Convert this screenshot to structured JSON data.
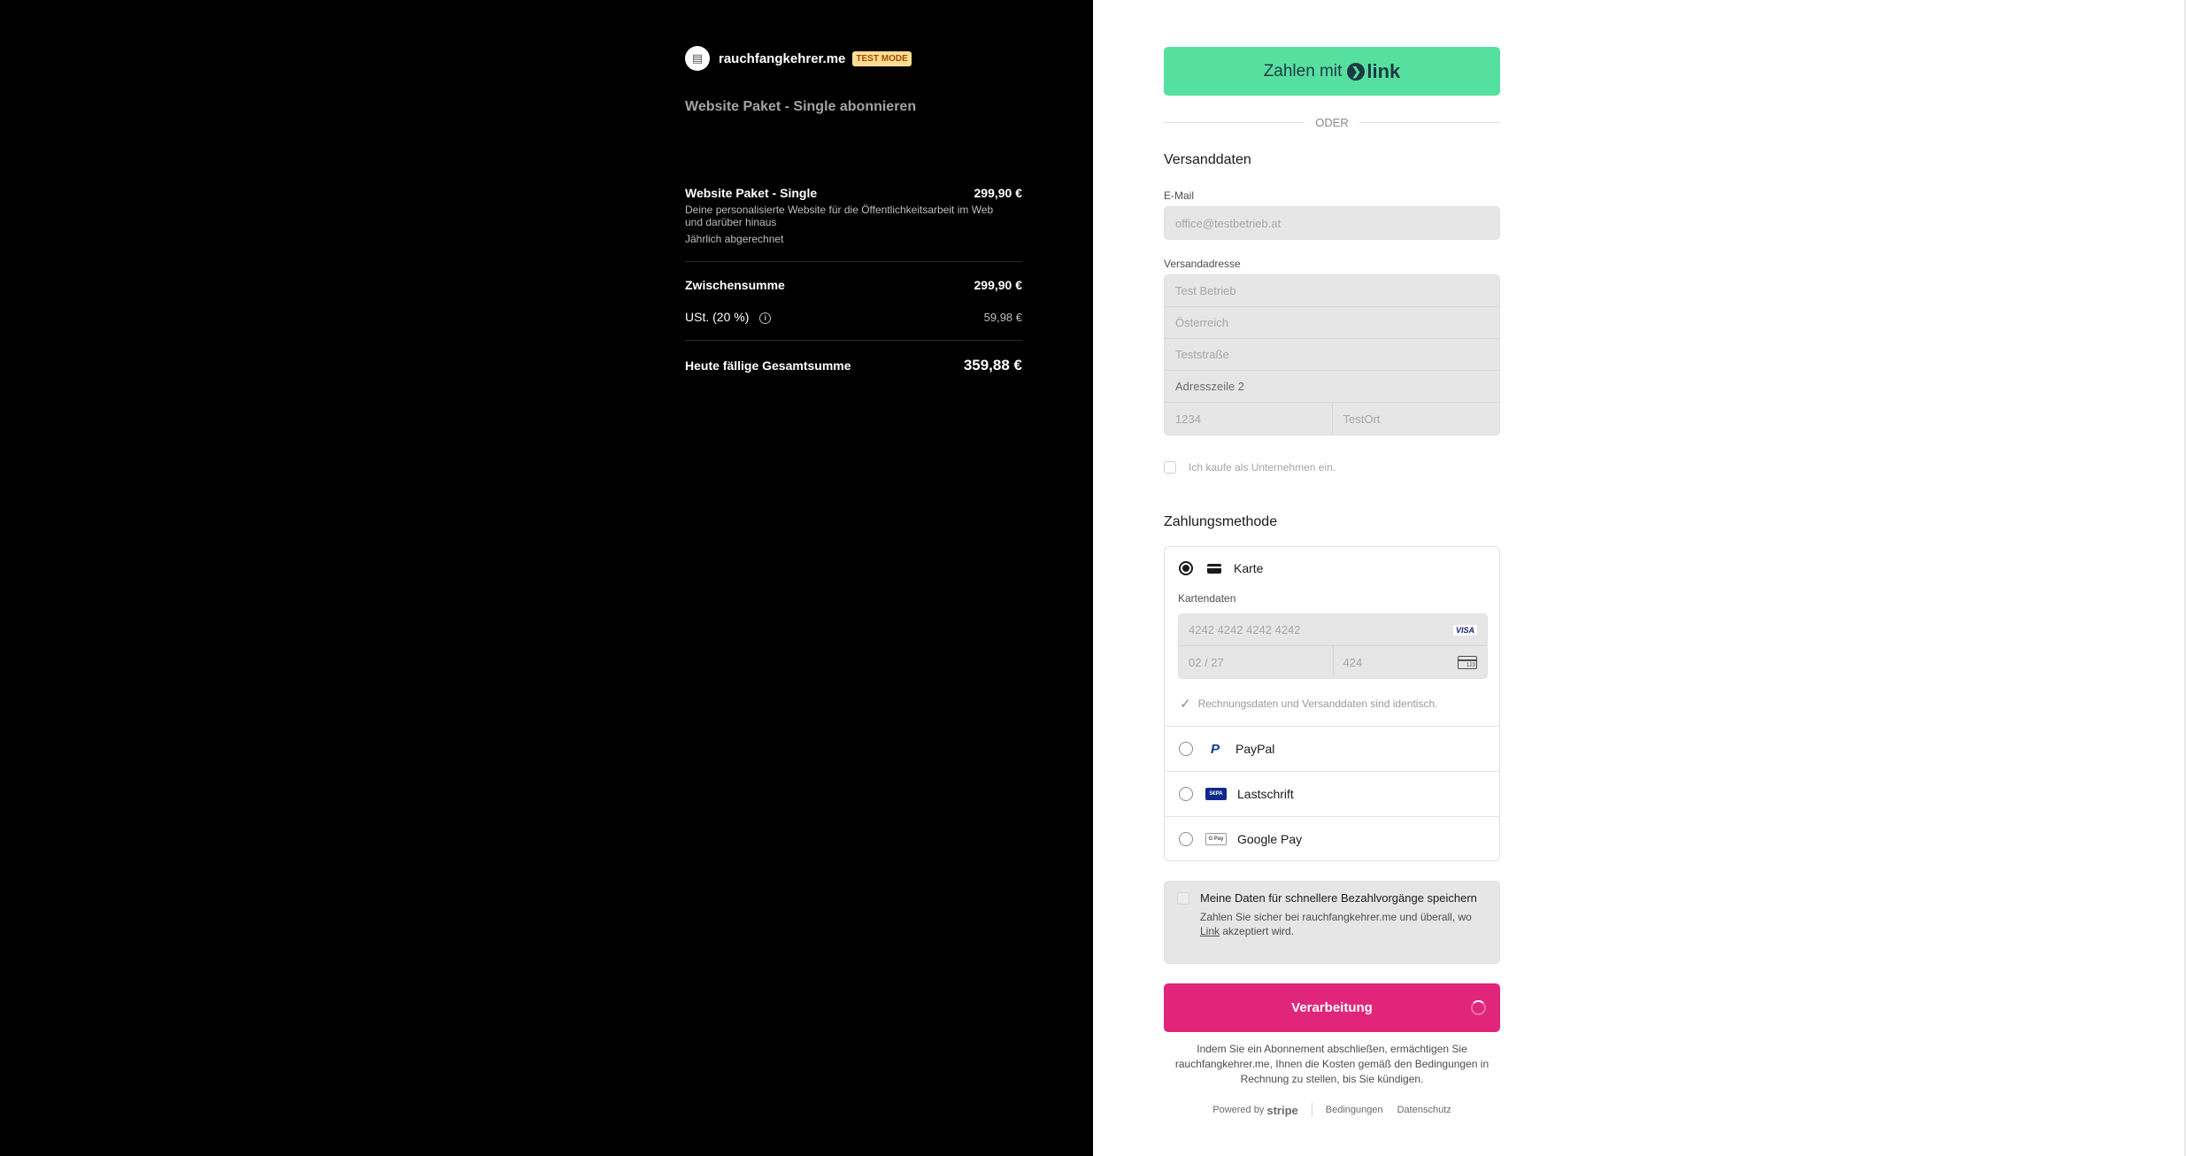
{
  "merchant": {
    "logo_glyph": "▤",
    "name": "rauchfangkehrer.me",
    "test_badge": "TEST MODE"
  },
  "product_heading": "Website Paket - Single abonnieren",
  "summary": {
    "item": {
      "name": "Website Paket - Single",
      "price": "299,90 €",
      "description": "Deine personalisierte Website für die Öffentlichkeitsarbeit im Web und darüber hinaus",
      "billing": "Jährlich abgerechnet"
    },
    "subtotal_label": "Zwischensumme",
    "subtotal_value": "299,90 €",
    "tax_label": "USt. (20 %)",
    "tax_info_glyph": "i",
    "tax_value": "59,98 €",
    "total_label": "Heute fällige Gesamtsumme",
    "total_value": "359,88 €"
  },
  "link_button": {
    "label": "Zahlen mit",
    "logo_arrow": "❯",
    "logo_text": "link"
  },
  "divider_text": "ODER",
  "shipping": {
    "title": "Versanddaten",
    "email_label": "E-Mail",
    "email_value": "office@testbetrieb.at",
    "address_label": "Versandadresse",
    "name": "Test Betrieb",
    "country": "Österreich",
    "street": "Teststraße",
    "line2_placeholder": "Adresszeile 2",
    "zip": "1234",
    "city": "TestOrt",
    "company_checkbox_label": "Ich kaufe als Unternehmen ein."
  },
  "payment": {
    "title": "Zahlungsmethode",
    "card_label": "Karte",
    "card_data_label": "Kartendaten",
    "card_number": "4242 4242 4242 4242",
    "card_brand": "VISA",
    "expiry": "02 / 27",
    "cvc": "424",
    "cvc_icon_text": "123",
    "check_glyph": "✓",
    "billing_same_label": "Rechnungsdaten und Versanddaten sind identisch.",
    "paypal_glyph": "P",
    "paypal_label": "PayPal",
    "sepa_badge": "S€PA",
    "sepa_label": "Lastschrift",
    "gpay_badge": "G Pay",
    "gpay_label": "Google Pay"
  },
  "save_info": {
    "title": "Meine Daten für schnellere Bezahlvorgänge speichern",
    "text_before": "Zahlen Sie sicher bei rauchfangkehrer.me und überall, wo ",
    "text_link": "Link",
    "text_after": " akzeptiert wird."
  },
  "process_button": "Verarbeitung",
  "legal_text": "Indem Sie ein Abonnement abschließen, ermächtigen Sie rauchfangkehrer.me, Ihnen die Kosten gemäß den Bedingungen in Rechnung zu stellen, bis Sie kündigen.",
  "footer": {
    "powered_by": "Powered by",
    "stripe": "stripe",
    "terms": "Bedingungen",
    "privacy": "Datenschutz"
  },
  "colors": {
    "left_background": "#000000",
    "link_green": "#56e0a0",
    "process_pink": "#e0257a",
    "test_badge": "#ffde92"
  }
}
